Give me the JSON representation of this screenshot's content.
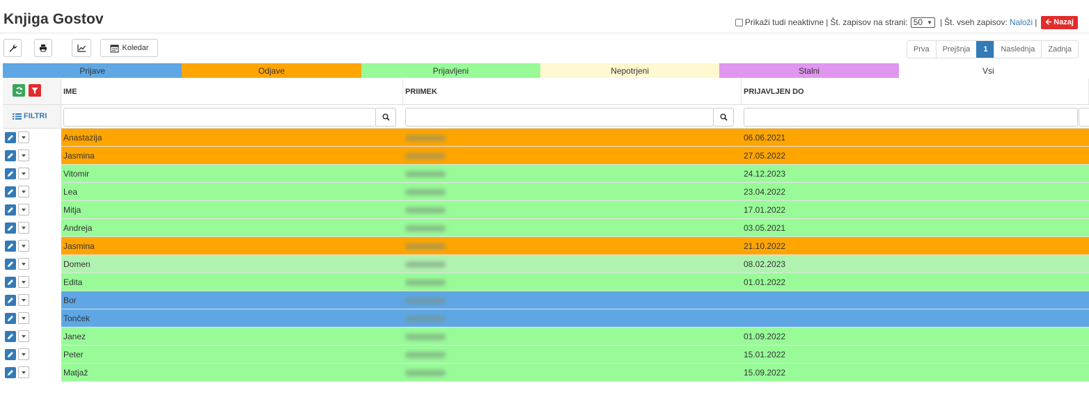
{
  "page": {
    "title": "Knjiga Gostov"
  },
  "header_controls": {
    "show_inactive_label": "Prikaži tudi neaktivne",
    "per_page_label": "Št. zapisov na strani:",
    "per_page_value": "50",
    "total_label": "Št. vseh zapisov:",
    "load_link": "Naloži",
    "back_button": "Nazaj"
  },
  "toolbar": {
    "settings_icon": "wrench-icon",
    "print_icon": "print-icon",
    "stats_icon": "line-chart-icon",
    "calendar_label": "Koledar"
  },
  "pagination": {
    "first": "Prva",
    "previous": "Prejšnja",
    "current": "1",
    "next": "Naslednja",
    "last": "Zadnja"
  },
  "status_tabs": [
    {
      "label": "Prijave",
      "color": "#5ea7e4"
    },
    {
      "label": "Odjave",
      "color": "#ffa500"
    },
    {
      "label": "Prijavljeni",
      "color": "#98fb98"
    },
    {
      "label": "Nepotrjeni",
      "color": "#fff8d0"
    },
    {
      "label": "Stalni",
      "color": "#e096ee"
    },
    {
      "label": "Vsi",
      "color": "#ffffff"
    }
  ],
  "table": {
    "columns": [
      "IME",
      "PRIIMEK",
      "PRIJAVLJEN DO"
    ],
    "filter_label": "FILTRI",
    "rows": [
      {
        "ime": "Anastazija",
        "do": "06.06.2021",
        "color": "#ffa500"
      },
      {
        "ime": "Jasmina",
        "do": "27.05.2022",
        "color": "#ffa500"
      },
      {
        "ime": "Vitomir",
        "do": "24.12.2023",
        "color": "#98fb98"
      },
      {
        "ime": "Lea",
        "do": "23.04.2022",
        "color": "#98fb98"
      },
      {
        "ime": "Mitja",
        "do": "17.01.2022",
        "color": "#98fb98"
      },
      {
        "ime": "Andreja",
        "do": "03.05.2021",
        "color": "#98fb98"
      },
      {
        "ime": "Jasmina",
        "do": "21.10.2022",
        "color": "#ffa500"
      },
      {
        "ime": "Domen",
        "do": "08.02.2023",
        "color": "#b0f3b0"
      },
      {
        "ime": "Edita",
        "do": "01.01.2022",
        "color": "#98fb98"
      },
      {
        "ime": "Bor",
        "do": "",
        "color": "#5ea7e4"
      },
      {
        "ime": "Tonček",
        "do": "",
        "color": "#5ea7e4"
      },
      {
        "ime": "Janez",
        "do": "01.09.2022",
        "color": "#98fb98"
      },
      {
        "ime": "Peter",
        "do": "15.01.2022",
        "color": "#98fb98"
      },
      {
        "ime": "Matjaž",
        "do": "15.09.2022",
        "color": "#98fb98"
      }
    ]
  }
}
